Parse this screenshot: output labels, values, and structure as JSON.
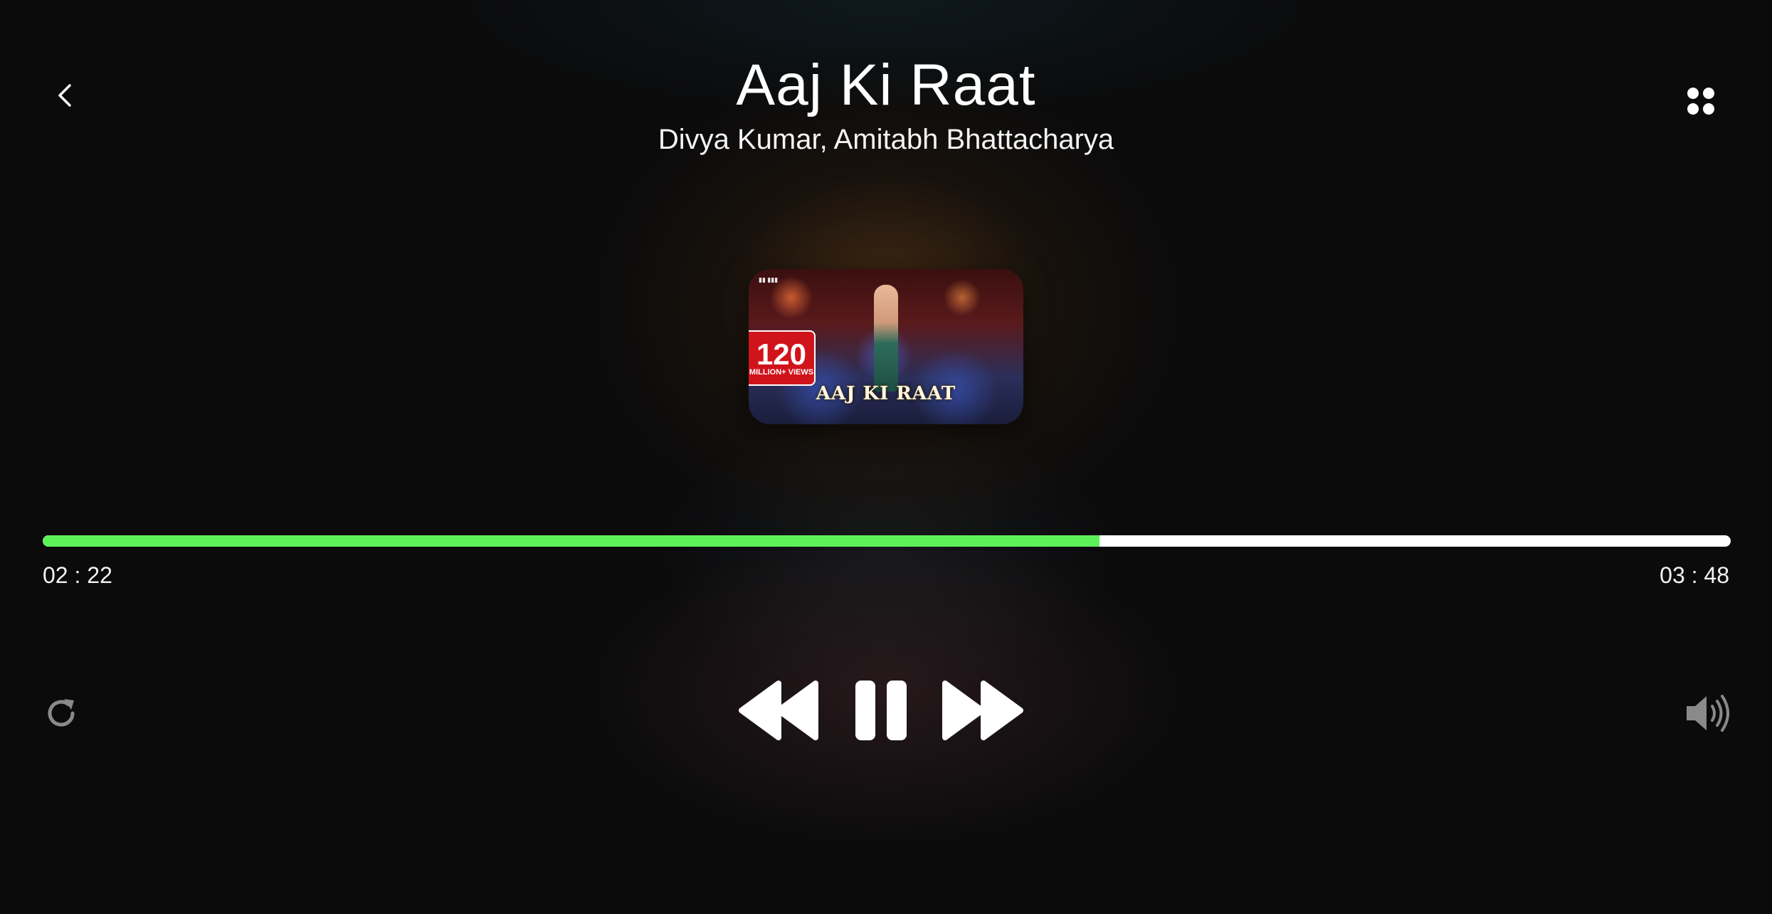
{
  "header": {
    "title": "Aaj Ki Raat",
    "artists": "Divya Kumar, Amitabh Bhattacharya",
    "back_icon": "chevron-left-icon",
    "menu_icon": "grid-dots-icon"
  },
  "artwork": {
    "badge_number": "120",
    "badge_text": "MILLION+ VIEWS",
    "logo_text": "AAJ KI RAAT"
  },
  "playback": {
    "elapsed": "02 : 22",
    "total": "03 : 48",
    "progress_fraction": 0.626,
    "progress_color": "#5ef25a",
    "track_color": "#ffffff"
  },
  "controls": {
    "repeat_icon": "repeat-icon",
    "previous_icon": "rewind-icon",
    "pause_icon": "pause-icon",
    "next_icon": "fast-forward-icon",
    "volume_icon": "volume-icon"
  }
}
